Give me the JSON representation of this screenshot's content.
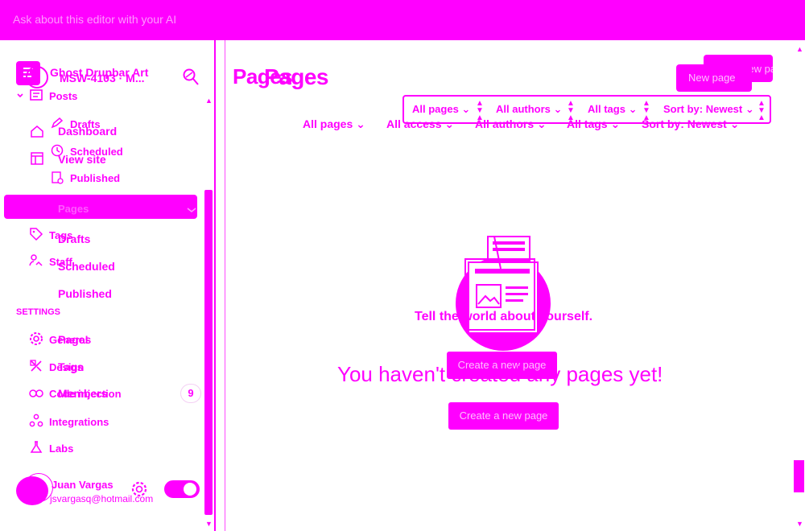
{
  "top_bar": {
    "placeholder": "Ask about this editor with your AI"
  },
  "site": {
    "title_a": "Ghost Drupbar Art",
    "title_b": "MSW-4103 · M..."
  },
  "nav_expanded": {
    "posts": "Posts",
    "drafts": "Drafts",
    "scheduled": "Scheduled",
    "published": "Published"
  },
  "nav": {
    "dashboard": "Dashboard",
    "view_site": "View site",
    "pages_active": "Pages",
    "tags": "Tags",
    "staff": "Staff"
  },
  "nav_ghost": {
    "drafts": "Drafts",
    "scheduled": "Scheduled",
    "published": "Published",
    "pages": "Pages",
    "tags": "Tags",
    "members": "Members"
  },
  "settings": {
    "heading": "SETTINGS",
    "general": "General",
    "design": "Design",
    "code_injection": "Code injection",
    "integrations": "Integrations",
    "labs": "Labs",
    "badge": "9"
  },
  "user": {
    "name": "Juan Vargas",
    "email": "jsvargasq@hotmail.com"
  },
  "header": {
    "title_a": "Pages",
    "title_b": "Pages",
    "new_button": "New page",
    "new_button_b": "New page"
  },
  "filters_primary": [
    "All pages",
    "All authors",
    "All tags",
    "Sort by: Newest"
  ],
  "filters_secondary": [
    "All pages",
    "All access",
    "All authors",
    "All tags",
    "Sort by: Newest"
  ],
  "empty_state": {
    "tagline": "Tell the world about yourself.",
    "heading": "You haven't created any pages yet!",
    "cta_primary": "Create a new page",
    "cta_secondary": "Create a new page"
  },
  "colors": {
    "accent": "#ff00ff",
    "background": "#ffffff"
  }
}
